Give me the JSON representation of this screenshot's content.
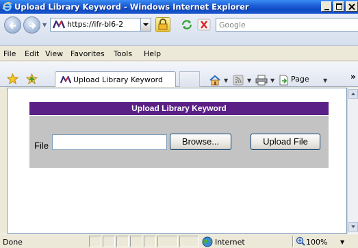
{
  "window": {
    "title": "Upload Library Keyword - Windows Internet Explorer"
  },
  "address_bar": {
    "url": "https://ifr-bl6-2",
    "search_placeholder": "Google"
  },
  "menu": {
    "items": [
      "File",
      "Edit",
      "View",
      "Favorites",
      "Tools",
      "Help"
    ]
  },
  "tabs": {
    "active_tab_label": "Upload Library Keyword"
  },
  "command_bar": {
    "page_label": "Page",
    "overflow": "»"
  },
  "page": {
    "header": "Upload Library Keyword",
    "file_label": "File",
    "file_value": "",
    "browse_label": "Browse...",
    "upload_label": "Upload File"
  },
  "status_bar": {
    "status_text": "Done",
    "zone_label": "Internet",
    "zoom_label": "100%"
  },
  "colors": {
    "header_bg": "#5b2086",
    "panel_bg": "#c3c3c3",
    "titlebar": "#0f4bc4"
  }
}
